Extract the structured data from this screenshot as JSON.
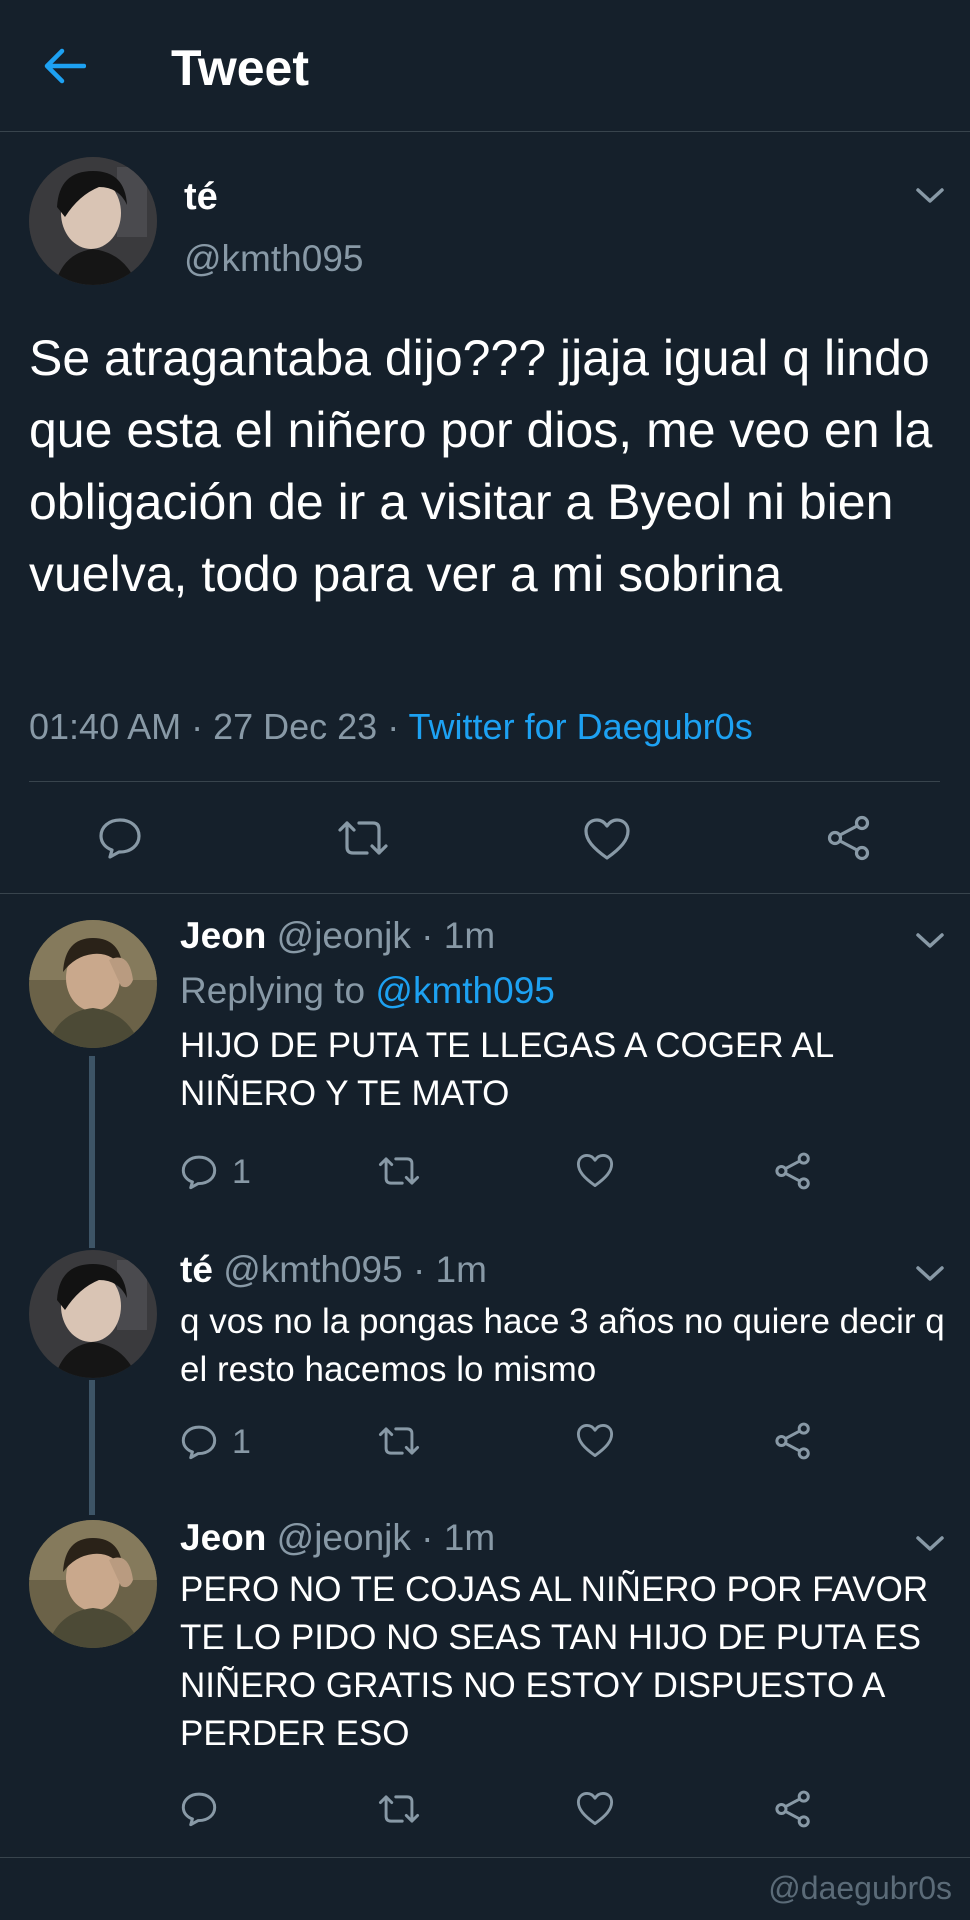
{
  "header": {
    "title": "Tweet",
    "back_icon": "arrow-left-icon",
    "accent": "#1da1f2"
  },
  "main_tweet": {
    "name": "té",
    "handle": "@kmth095",
    "text": "Se atragantaba dijo??? jjaja igual q lindo que esta el niñero por dios, me veo en la obligación de ir a visitar a Byeol ni bien vuelva, todo para ver a mi sobrina",
    "meta_prefix": "01:40 AM · 27 Dec 23 · ",
    "source": "Twitter for Daegubr0s"
  },
  "replies": [
    {
      "name": "Jeon",
      "meta": "@jeonjk · 1m",
      "replying_prefix": "Replying to ",
      "replying_handle": "@kmth095",
      "text": "HIJO DE PUTA TE LLEGAS A COGER AL NIÑERO Y TE MATO",
      "reply_count": "1"
    },
    {
      "name": "té",
      "meta": "@kmth095 · 1m",
      "text": "q vos no la pongas hace 3 años no quiere decir q el resto hacemos lo mismo",
      "reply_count": "1"
    },
    {
      "name": "Jeon",
      "meta": "@jeonjk · 1m",
      "text": "PERO NO TE COJAS AL NIÑERO POR FAVOR TE LO PIDO NO SEAS TAN HIJO DE PUTA ES NIÑERO GRATIS NO ESTOY DISPUESTO A PERDER ESO",
      "reply_count": ""
    }
  ],
  "watermark": "@daegubr0s",
  "colors": {
    "background": "#15202b",
    "secondary_text": "#8899a6",
    "divider": "#38444d"
  }
}
